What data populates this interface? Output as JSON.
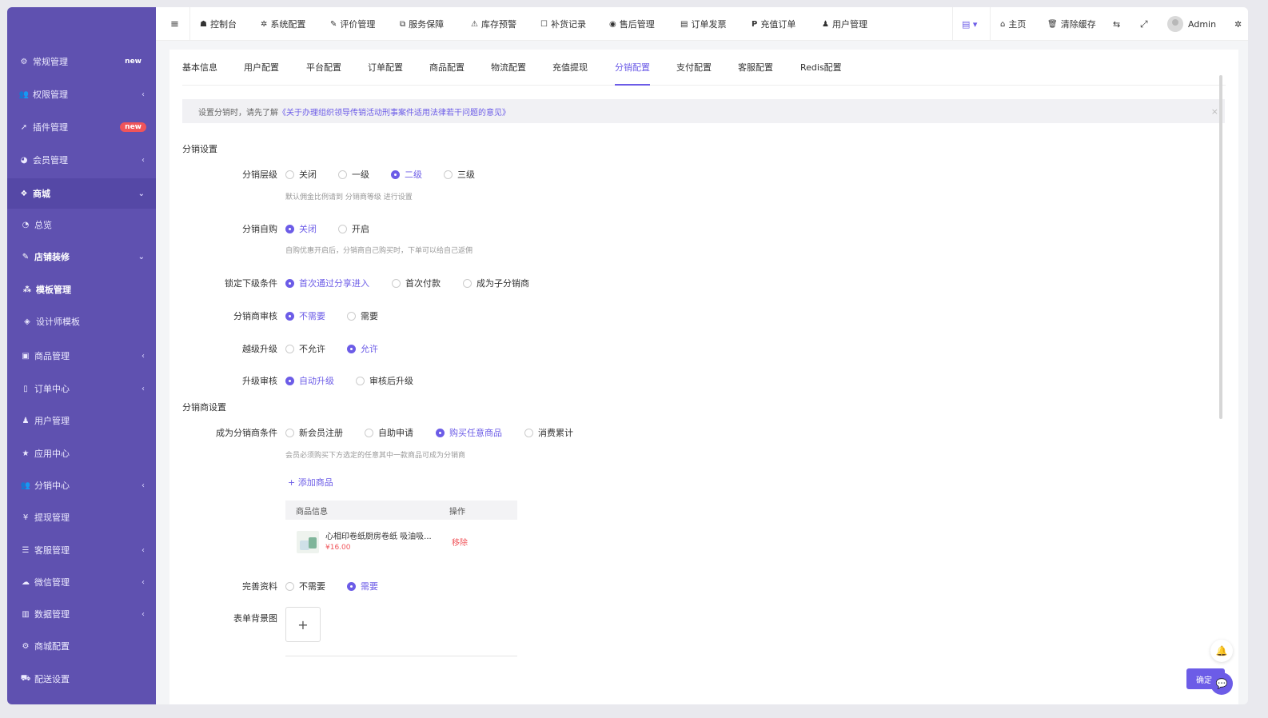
{
  "sidebar": {
    "items": [
      {
        "label": "常规管理",
        "icon": "gears-icon",
        "badge": "new"
      },
      {
        "label": "权限管理",
        "icon": "users-icon",
        "arrow": "‹"
      },
      {
        "label": "插件管理",
        "icon": "rocket-icon",
        "badge": "new"
      },
      {
        "label": "会员管理",
        "icon": "user-circle-icon",
        "arrow": "‹"
      },
      {
        "label": "商城",
        "icon": "dropbox-icon",
        "arrow": "⌄"
      },
      {
        "label": "总览",
        "icon": "pie-chart-icon"
      },
      {
        "label": "店铺装修",
        "icon": "paint-brush-icon",
        "arrow": "⌄"
      },
      {
        "label": "模板管理",
        "icon": "cubes-icon"
      },
      {
        "label": "设计师模板",
        "icon": "cube-icon"
      },
      {
        "label": "商品管理",
        "icon": "inbox-icon",
        "arrow": "‹"
      },
      {
        "label": "订单中心",
        "icon": "file-icon",
        "arrow": "‹"
      },
      {
        "label": "用户管理",
        "icon": "user-icon"
      },
      {
        "label": "应用中心",
        "icon": "star-icon"
      },
      {
        "label": "分销中心",
        "icon": "users-icon",
        "arrow": "‹"
      },
      {
        "label": "提现管理",
        "icon": "yen-icon"
      },
      {
        "label": "客服管理",
        "icon": "list-icon",
        "arrow": "‹"
      },
      {
        "label": "微信管理",
        "icon": "wechat-icon",
        "arrow": "‹"
      },
      {
        "label": "数据管理",
        "icon": "bar-chart-icon",
        "arrow": "‹"
      },
      {
        "label": "商城配置",
        "icon": "gears-icon"
      },
      {
        "label": "配送设置",
        "icon": "car-icon"
      }
    ]
  },
  "topbar": {
    "menu_icon": "≡",
    "nav": [
      {
        "label": "控制台",
        "icon": "dashboard-icon",
        "glyph": "☗"
      },
      {
        "label": "系统配置",
        "icon": "gear-icon",
        "glyph": "✲"
      },
      {
        "label": "评价管理",
        "icon": "edit-icon",
        "glyph": "✎"
      },
      {
        "label": "服务保障",
        "icon": "tags-icon",
        "glyph": "⧉"
      },
      {
        "label": "库存预警",
        "icon": "warning-icon",
        "glyph": "⚠"
      },
      {
        "label": "补货记录",
        "icon": "square-icon",
        "glyph": "☐"
      },
      {
        "label": "售后管理",
        "icon": "eye-icon",
        "glyph": "◉"
      },
      {
        "label": "订单发票",
        "icon": "file-text-icon",
        "glyph": "▤"
      },
      {
        "label": "充值订单",
        "icon": "paypal-icon",
        "glyph": "P"
      },
      {
        "label": "用户管理",
        "icon": "user-icon",
        "glyph": "♟"
      }
    ],
    "right": {
      "list_dropdown": "▤ ▾",
      "home": "主页",
      "clear_cache": "清除缓存",
      "translate_glyph": "⇆",
      "fullscreen_glyph": "⤢",
      "username": "Admin",
      "settings_glyph": "✲"
    }
  },
  "tabs": [
    "基本信息",
    "用户配置",
    "平台配置",
    "订单配置",
    "商品配置",
    "物流配置",
    "充值提现",
    "分销配置",
    "支付配置",
    "客服配置",
    "Redis配置"
  ],
  "active_tab": "分销配置",
  "notice": {
    "prefix": "设置分销时，请先了解",
    "link": "《关于办理组织领导传销活动刑事案件适用法律若干问题的意见》",
    "close": "×"
  },
  "form": {
    "section1": "分销设置",
    "level": {
      "label": "分销层级",
      "options": [
        "关闭",
        "一级",
        "二级",
        "三级"
      ],
      "selected": "二级",
      "help": "默认佣金比例请到 分销商等级 进行设置"
    },
    "self_buy": {
      "label": "分销自购",
      "options": [
        "关闭",
        "开启"
      ],
      "selected": "关闭",
      "help": "自购优惠开启后，分销商自己购买时，下单可以给自己返佣"
    },
    "lock": {
      "label": "锁定下级条件",
      "options": [
        "首次通过分享进入",
        "首次付款",
        "成为子分销商"
      ],
      "selected": "首次通过分享进入"
    },
    "audit": {
      "label": "分销商审核",
      "options": [
        "不需要",
        "需要"
      ],
      "selected": "不需要"
    },
    "skip_upgrade": {
      "label": "越级升级",
      "options": [
        "不允许",
        "允许"
      ],
      "selected": "允许"
    },
    "upgrade_audit": {
      "label": "升级审核",
      "options": [
        "自动升级",
        "审核后升级"
      ],
      "selected": "自动升级"
    },
    "section2": "分销商设置",
    "become": {
      "label": "成为分销商条件",
      "options": [
        "新会员注册",
        "自助申请",
        "购买任意商品",
        "消费累计"
      ],
      "selected": "购买任意商品",
      "help": "会员必须购买下方选定的任意其中一款商品可成为分销商"
    },
    "add_product": "+ 添加商品",
    "product_table": {
      "headers": [
        "商品信息",
        "操作"
      ],
      "rows": [
        {
          "name": "心相印卷纸厨房卷纸 吸油吸...",
          "price": "¥16.00",
          "action": "移除"
        }
      ]
    },
    "complete_info": {
      "label": "完善资料",
      "options": [
        "不需要",
        "需要"
      ],
      "selected": "需要"
    },
    "bg_image": {
      "label": "表单背景图",
      "plus": "+"
    }
  },
  "footer": {
    "confirm": "确定"
  }
}
